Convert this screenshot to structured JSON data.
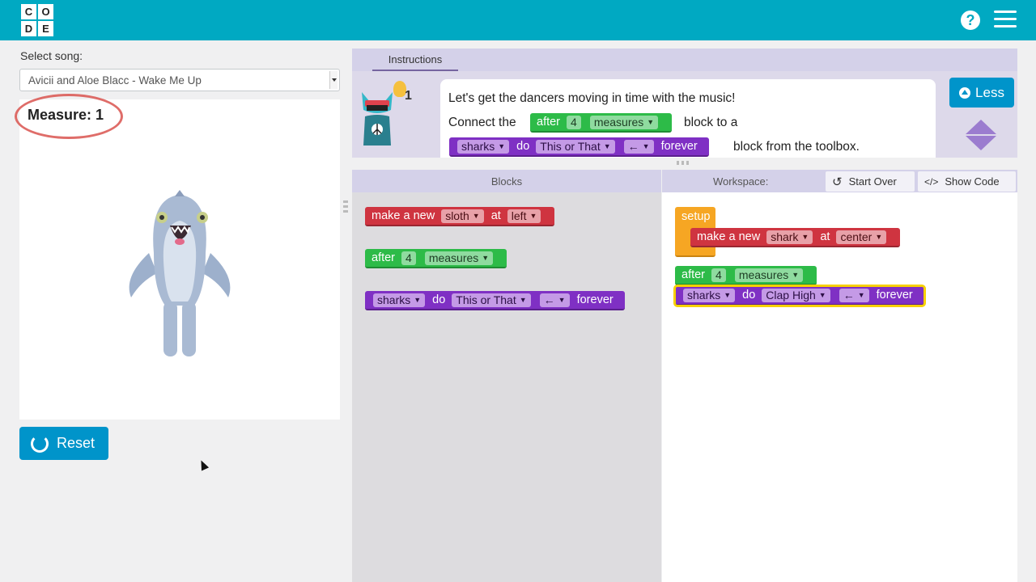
{
  "header": {
    "logo_letters": [
      "C",
      "O",
      "D",
      "E"
    ],
    "help_icon": "question-circle-icon",
    "menu_icon": "hamburger-menu-icon",
    "color": "#00a9c2"
  },
  "left": {
    "song_label": "Select song:",
    "song_value": "Avicii and Aloe Blacc - Wake Me Up",
    "measure": "Measure: 1",
    "reset_label": "Reset"
  },
  "instructions": {
    "tab": "Instructions",
    "hint_count": "1",
    "line1": "Let's get the dancers moving in time with the music!",
    "line2_pre": "Connect the",
    "line2_post": "block to a",
    "line3_post": "block from the toolbox.",
    "less_label": "Less"
  },
  "blocks_header": "Blocks",
  "workspace_header": "Workspace:",
  "start_over": "Start Over",
  "show_code": "Show Code",
  "block_text": {
    "make_a_new": "make a new",
    "at": "at",
    "after": "after",
    "measures": "measures",
    "do": "do",
    "forever": "forever",
    "setup": "setup"
  },
  "block_fields": {
    "sloth": "sloth",
    "left": "left",
    "four": "4",
    "measures": "measures",
    "sharks": "sharks",
    "this_or_that": "This or That",
    "arrow_left": "←",
    "shark": "shark",
    "center": "center",
    "clap_high": "Clap High"
  },
  "colors": {
    "green": "#2dbb48",
    "red": "#cf3440",
    "purple": "#7f30c4",
    "orange": "#f6a623",
    "accent_blue": "#0094ca",
    "selection": "#f7d000"
  }
}
